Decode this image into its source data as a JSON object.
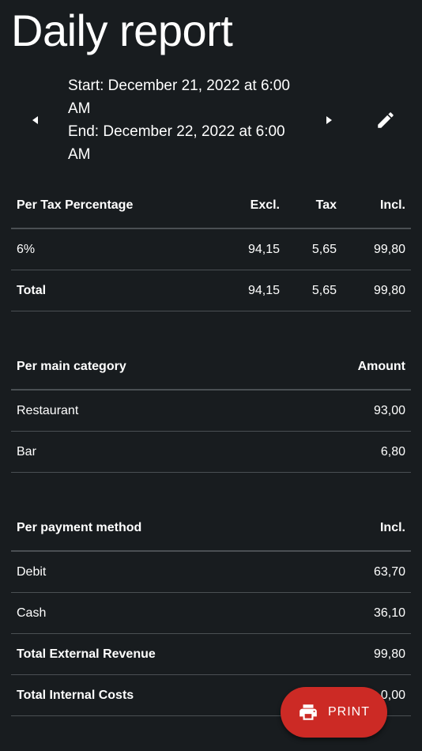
{
  "page": {
    "title": "Daily report"
  },
  "date_range": {
    "start": "Start: December 21, 2022 at 6:00 AM",
    "end": "End: December 22, 2022 at 6:00 AM"
  },
  "icons": {
    "prev": "arrow-left-icon",
    "next": "arrow-right-icon",
    "edit": "pencil-icon",
    "print": "printer-icon"
  },
  "tax_table": {
    "headers": {
      "label": "Per Tax Percentage",
      "excl": "Excl.",
      "tax": "Tax",
      "incl": "Incl."
    },
    "rows": [
      {
        "label": "6%",
        "excl": "94,15",
        "tax": "5,65",
        "incl": "99,80"
      }
    ],
    "total": {
      "label": "Total",
      "excl": "94,15",
      "tax": "5,65",
      "incl": "99,80"
    }
  },
  "category_table": {
    "headers": {
      "label": "Per main category",
      "amount": "Amount"
    },
    "rows": [
      {
        "label": "Restaurant",
        "amount": "93,00"
      },
      {
        "label": "Bar",
        "amount": "6,80"
      }
    ]
  },
  "payment_table": {
    "headers": {
      "label": "Per payment method",
      "incl": "Incl."
    },
    "rows": [
      {
        "label": "Debit",
        "incl": "63,70"
      },
      {
        "label": "Cash",
        "incl": "36,10"
      }
    ],
    "total_external": {
      "label": "Total External Revenue",
      "incl": "99,80"
    },
    "total_internal": {
      "label": "Total Internal Costs",
      "incl": "0,00"
    }
  },
  "print_button": {
    "label": "PRINT"
  },
  "colors": {
    "background": "#181c1f",
    "text": "#ffffff",
    "divider": "#4a4f53",
    "print_button": "#cc2a25"
  }
}
